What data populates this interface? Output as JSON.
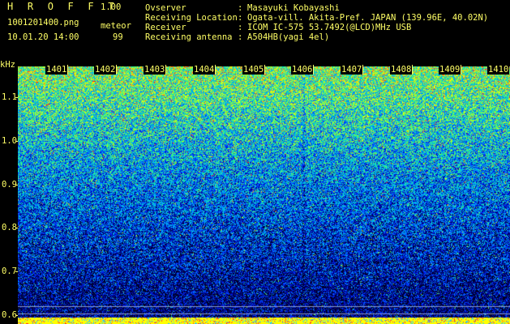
{
  "header": {
    "app_name": "H R O F F T",
    "version": "1.00",
    "filename": "1001201400.png",
    "datetime": "10.01.20 14:00",
    "event_type": "meteor",
    "event_count": "99"
  },
  "station_info": [
    {
      "label": "Ovserver",
      "value": "Masayuki Kobayashi"
    },
    {
      "label": "Receiving Location",
      "value": "Ogata-vill. Akita-Pref. JAPAN (139.96E, 40.02N)"
    },
    {
      "label": "Receiver",
      "value": "ICOM IC-575 53.7492(@LCD)MHz USB"
    },
    {
      "label": "Receiving antenna",
      "value": "A504HB(yagi 4el)"
    }
  ],
  "chart_data": {
    "type": "heatmap",
    "title": "",
    "xlabel": "",
    "ylabel": "kHz",
    "y_unit": "kHz",
    "x_ticks": [
      "1401",
      "1402",
      "1403",
      "1404",
      "1405",
      "1406",
      "1407",
      "1408",
      "1409",
      "1410"
    ],
    "x_range": [
      "1400",
      "1410"
    ],
    "y_ticks": [
      "1.1",
      "1.0",
      "0.9",
      "0.8",
      "0.7",
      "0.6"
    ],
    "y_range": [
      0.58,
      1.17
    ],
    "colormap": [
      "#000020",
      "#000080",
      "#0020ff",
      "#00a0ff",
      "#00e0c0",
      "#80ff40",
      "#ffff00",
      "#ff2020"
    ],
    "reference_lines_khz": [
      0.605,
      0.62
    ],
    "reference_line_color": "#8899cc",
    "bottom_band_color": "#ffff00",
    "discontinuity_at": "1405.8"
  }
}
